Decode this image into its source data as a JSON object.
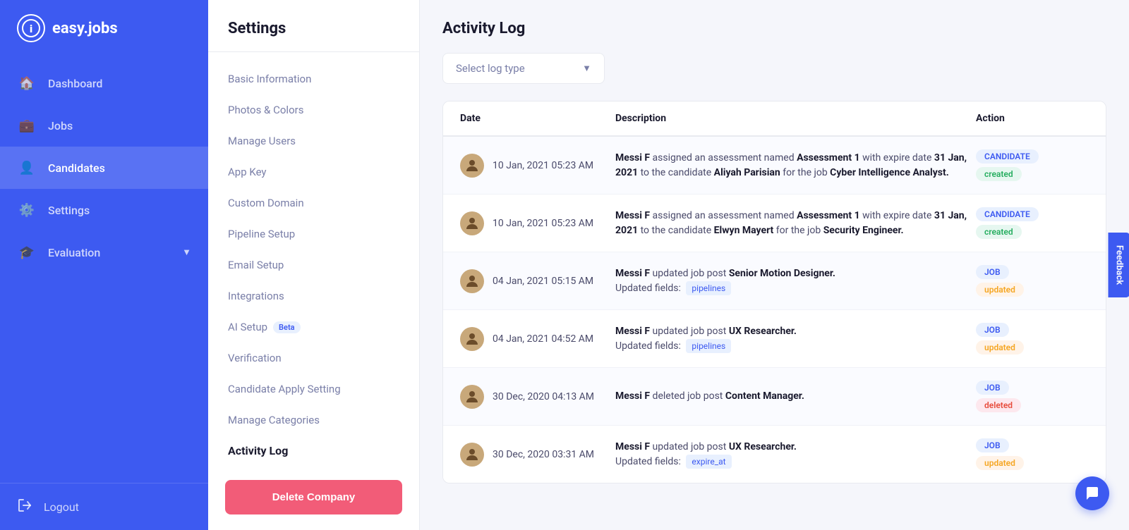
{
  "sidebar": {
    "logo_text": "easy.jobs",
    "logo_icon": "i",
    "nav_items": [
      {
        "id": "dashboard",
        "label": "Dashboard",
        "icon": "🏠"
      },
      {
        "id": "jobs",
        "label": "Jobs",
        "icon": "💼"
      },
      {
        "id": "candidates",
        "label": "Candidates",
        "icon": "👤",
        "active": true
      },
      {
        "id": "settings",
        "label": "Settings",
        "icon": "⚙️"
      },
      {
        "id": "evaluation",
        "label": "Evaluation",
        "icon": "🎓",
        "has_arrow": true
      }
    ],
    "logout_label": "Logout",
    "logout_icon": "🚪"
  },
  "settings": {
    "title": "Settings",
    "menu_items": [
      {
        "id": "basic-info",
        "label": "Basic Information"
      },
      {
        "id": "photos-colors",
        "label": "Photos & Colors"
      },
      {
        "id": "manage-users",
        "label": "Manage Users"
      },
      {
        "id": "app-key",
        "label": "App Key"
      },
      {
        "id": "custom-domain",
        "label": "Custom Domain"
      },
      {
        "id": "pipeline-setup",
        "label": "Pipeline Setup"
      },
      {
        "id": "email-setup",
        "label": "Email Setup"
      },
      {
        "id": "integrations",
        "label": "Integrations"
      },
      {
        "id": "ai-setup",
        "label": "AI Setup",
        "badge": "Beta"
      },
      {
        "id": "verification",
        "label": "Verification"
      },
      {
        "id": "candidate-apply",
        "label": "Candidate Apply Setting"
      },
      {
        "id": "manage-categories",
        "label": "Manage Categories"
      }
    ],
    "activity_log_label": "Activity Log",
    "delete_company_label": "Delete Company"
  },
  "activity_log": {
    "title": "Activity Log",
    "filter_placeholder": "Select log type",
    "table_headers": [
      "Date",
      "Description",
      "Action"
    ],
    "rows": [
      {
        "date": "10 Jan, 2021 05:23 AM",
        "description_parts": [
          {
            "text": "Messi F",
            "bold": true
          },
          {
            "text": " assigned an assessment named "
          },
          {
            "text": "Assessment 1",
            "bold": true
          },
          {
            "text": " with expire date "
          },
          {
            "text": "31 Jan, 2021",
            "bold": true
          },
          {
            "text": " to the candidate "
          },
          {
            "text": "Aliyah Parisian",
            "bold": true
          },
          {
            "text": " for the job "
          },
          {
            "text": "Cyber Intelligence Analyst.",
            "bold": true
          }
        ],
        "badge_type": "candidate",
        "badge_status": "created"
      },
      {
        "date": "10 Jan, 2021 05:23 AM",
        "description_parts": [
          {
            "text": "Messi F",
            "bold": true
          },
          {
            "text": " assigned an assessment named "
          },
          {
            "text": "Assessment 1",
            "bold": true
          },
          {
            "text": " with expire date "
          },
          {
            "text": "31 Jan, 2021",
            "bold": true
          },
          {
            "text": " to the candidate "
          },
          {
            "text": "Elwyn Mayert",
            "bold": true
          },
          {
            "text": " for the job "
          },
          {
            "text": "Security Engineer.",
            "bold": true
          }
        ],
        "badge_type": "candidate",
        "badge_status": "created"
      },
      {
        "date": "04 Jan, 2021 05:15 AM",
        "description_main": "Messi F updated job post Senior Motion Designer.",
        "description_field": "pipelines",
        "badge_type": "job",
        "badge_status": "updated"
      },
      {
        "date": "04 Jan, 2021 04:52 AM",
        "description_main": "Messi F updated job post UX Researcher.",
        "description_field": "pipelines",
        "badge_type": "job",
        "badge_status": "updated"
      },
      {
        "date": "30 Dec, 2020 04:13 AM",
        "description_main": "Messi F deleted job post Content Manager.",
        "badge_type": "job",
        "badge_status": "deleted"
      },
      {
        "date": "30 Dec, 2020 03:31 AM",
        "description_main": "Messi F updated job post UX Researcher.",
        "description_field": "expire_at",
        "badge_type": "job",
        "badge_status": "updated"
      }
    ]
  },
  "feedback_label": "Feedback"
}
